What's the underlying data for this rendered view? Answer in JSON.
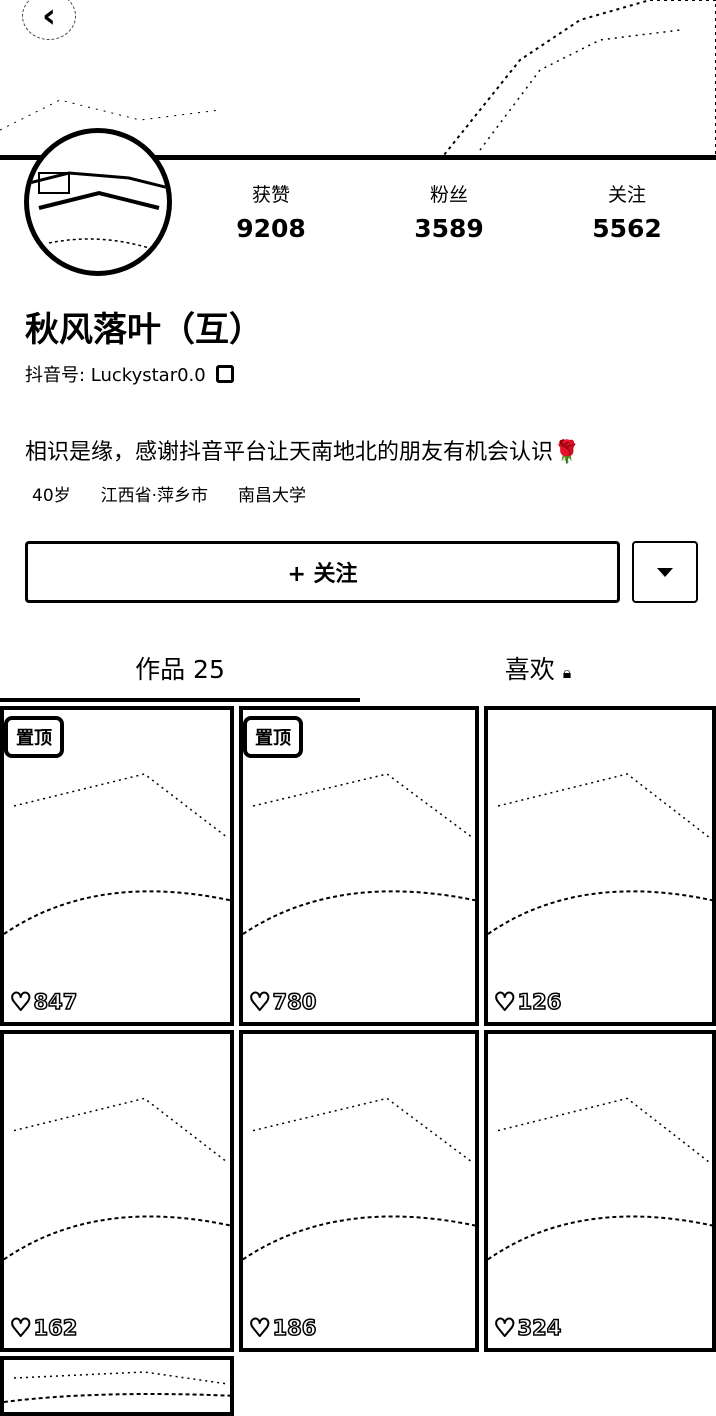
{
  "header": {
    "back_icon": "chevron-left-icon",
    "more_icon": "more-icon"
  },
  "profile": {
    "stats": [
      {
        "label": "获赞",
        "value": "9208"
      },
      {
        "label": "粉丝",
        "value": "3589"
      },
      {
        "label": "关注",
        "value": "5562"
      }
    ],
    "name": "秋风落叶（互）",
    "id_text": "抖音号: Luckystar0.0",
    "bio": "相识是缘，感谢抖音平台让天南地北的朋友有机会认识",
    "bio_emoji": "🌹",
    "tags": [
      "40岁",
      "江西省·萍乡市",
      "南昌大学"
    ]
  },
  "actions": {
    "follow_label": "+ 关注"
  },
  "tabs": [
    {
      "label": "作品 25"
    },
    {
      "label": "喜欢"
    }
  ],
  "videos": [
    {
      "pinned": "置顶",
      "likes": "847"
    },
    {
      "pinned": "置顶",
      "likes": "780"
    },
    {
      "pinned": "",
      "likes": "126"
    },
    {
      "pinned": "",
      "likes": "162"
    },
    {
      "pinned": "",
      "likes": "186"
    },
    {
      "pinned": "",
      "likes": "324"
    },
    {
      "pinned": "",
      "likes": ""
    }
  ]
}
